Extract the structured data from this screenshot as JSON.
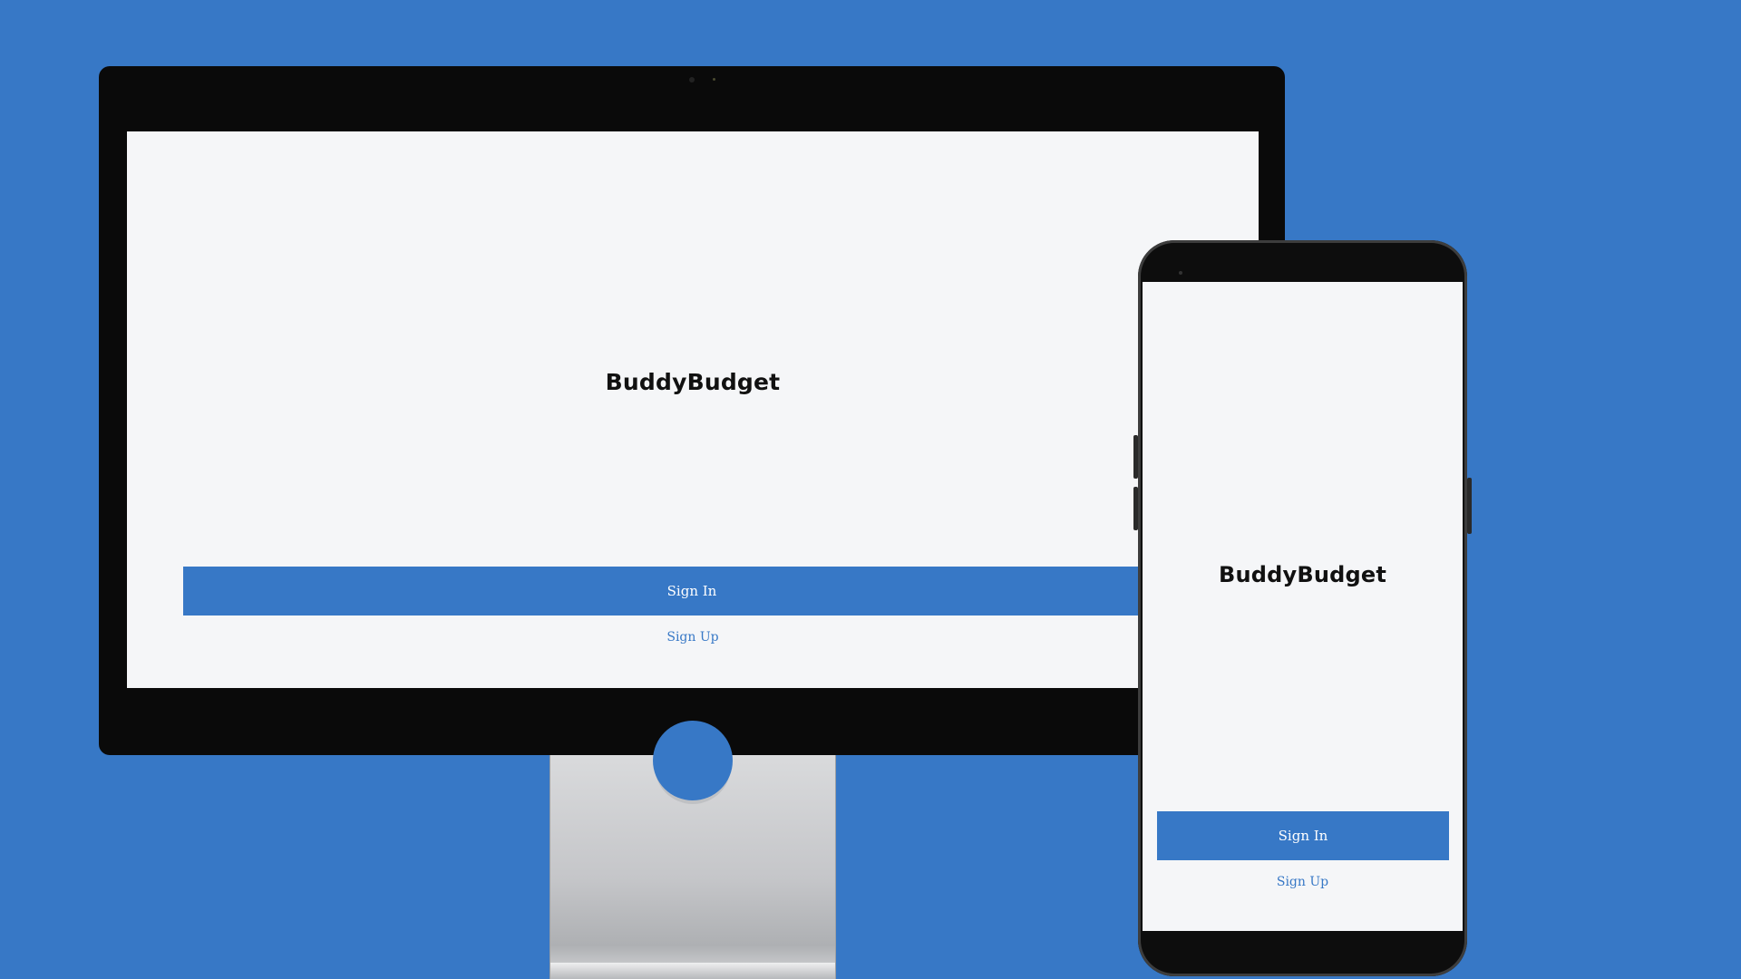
{
  "brand": {
    "name": "BuddyBudget"
  },
  "monitor": {
    "app_title": "BuddyBudget",
    "sign_in_label": "Sign In",
    "sign_up_label": "Sign Up"
  },
  "phone": {
    "app_title": "BuddyBudget",
    "sign_in_label": "Sign In",
    "sign_up_label": "Sign Up"
  },
  "colors": {
    "background": "#3778c6",
    "accent": "#3778c6",
    "screen": "#f5f6f8"
  }
}
